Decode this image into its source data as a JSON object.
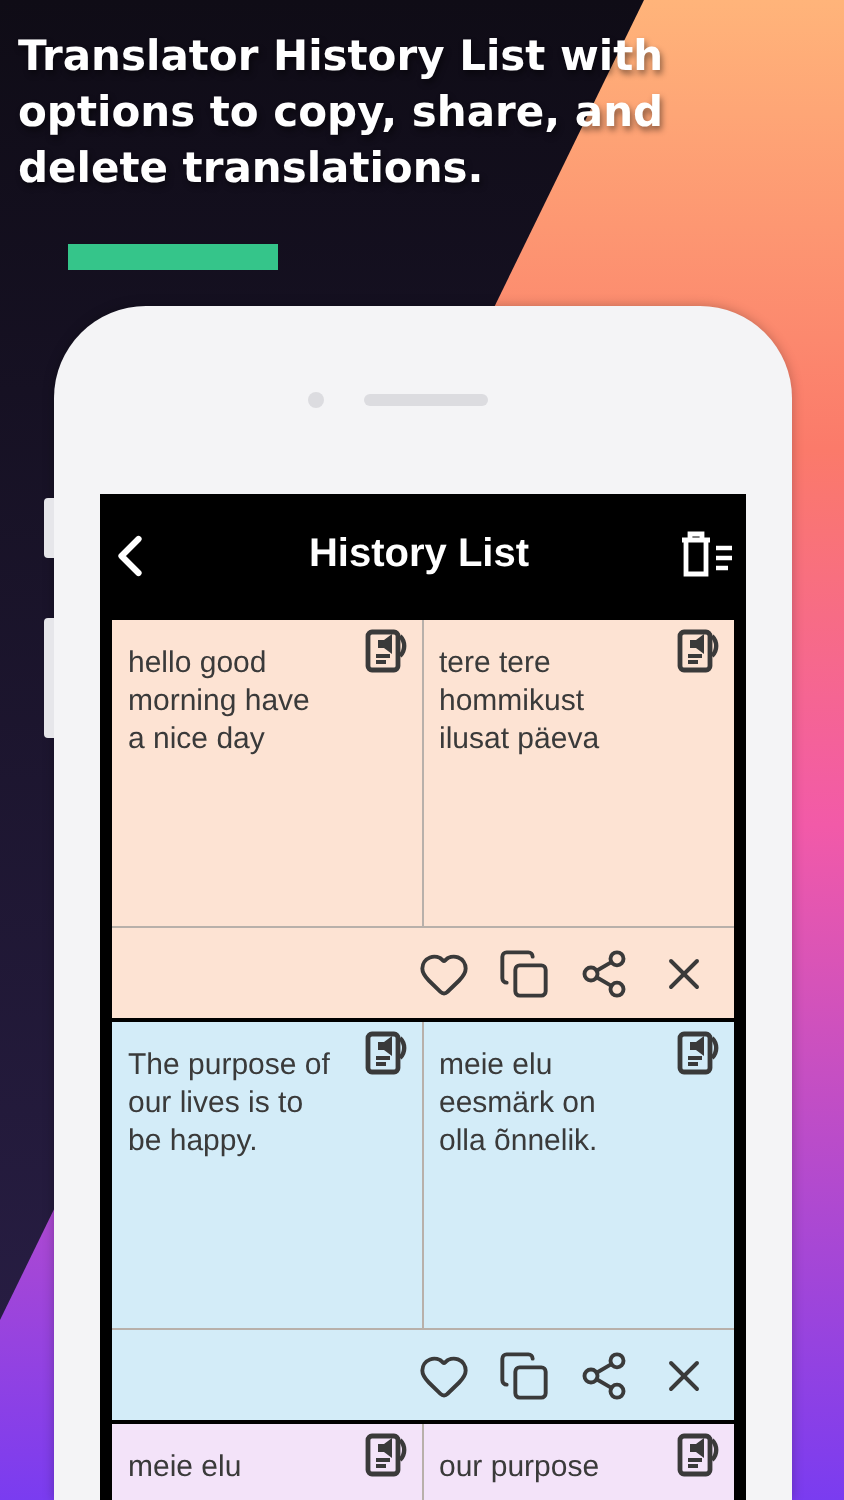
{
  "headline": "Translator History List with options to copy, share, and delete translations.",
  "app_bar": {
    "title": "History List"
  },
  "cards": [
    {
      "source": "hello good morning have a nice day",
      "translation": "tere tere hommikust ilusat päeva",
      "color": "#fde3d3"
    },
    {
      "source": "The purpose of our lives is to be happy.",
      "translation": "meie elu eesmärk on olla õnnelik.",
      "color": "#d3ecf8"
    },
    {
      "source": "meie elu",
      "translation": "our purpose",
      "color": "#f3e3f9"
    }
  ]
}
